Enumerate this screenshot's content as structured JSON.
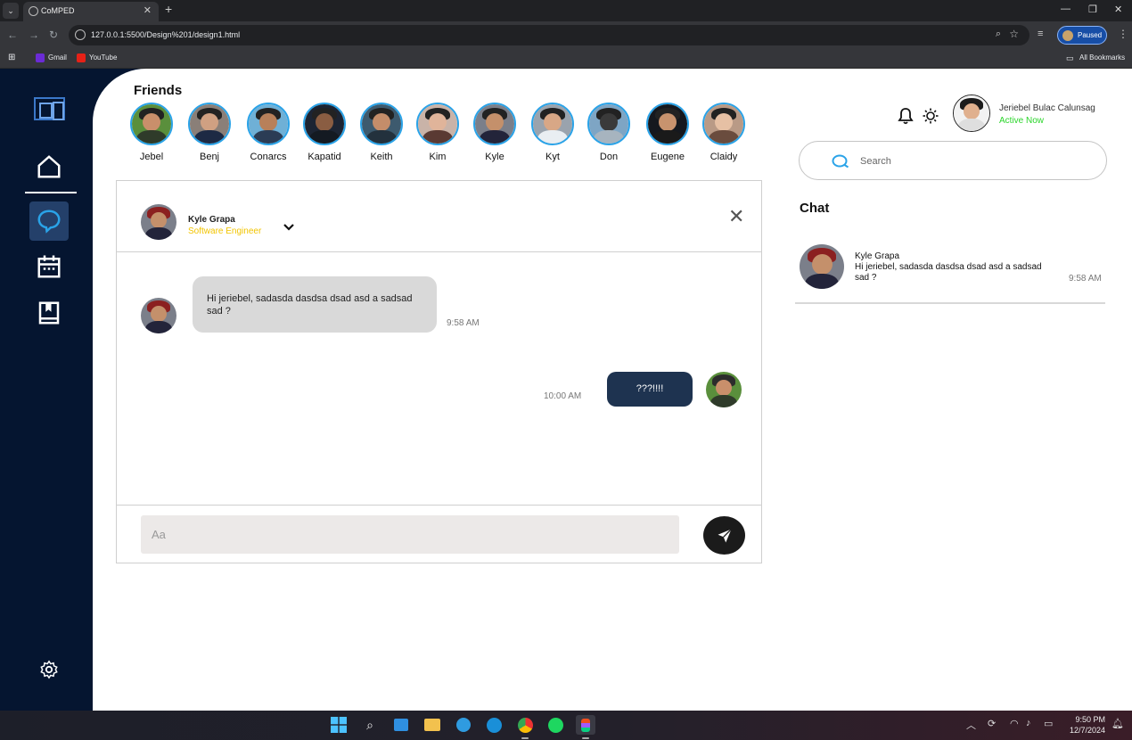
{
  "browser": {
    "tab_title": "CoMPED",
    "url": "127.0.0.1:5500/Design%201/design1.html",
    "profile_status": "Paused",
    "bookmarks": [
      "Gmail",
      "YouTube"
    ],
    "all_bookmarks": "All Bookmarks"
  },
  "friends": {
    "title": "Friends",
    "list": [
      {
        "name": "Jebel",
        "bg": "#5a8f3c",
        "skin": "#c98f6b",
        "shirt": "#2f3b2a"
      },
      {
        "name": "Benj",
        "bg": "#8a7f78",
        "skin": "#d0a082",
        "shirt": "#1d2a44"
      },
      {
        "name": "Conarcs",
        "bg": "#6fb0d6",
        "skin": "#b8805a",
        "shirt": "#2b3c55"
      },
      {
        "name": "Kapatid",
        "bg": "#1c2433",
        "skin": "#8a5d42",
        "shirt": "#141a22"
      },
      {
        "name": "Keith",
        "bg": "#3d5a6e",
        "skin": "#c48d6a",
        "shirt": "#23313d"
      },
      {
        "name": "Kim",
        "bg": "#c9b3a8",
        "skin": "#e0b49a",
        "shirt": "#5a3a33"
      },
      {
        "name": "Kyle",
        "bg": "#7b7f8a",
        "skin": "#c4906b",
        "shirt": "#23243a"
      },
      {
        "name": "Kyt",
        "bg": "#9aa3ad",
        "skin": "#d8a786",
        "shirt": "#e9eef2"
      },
      {
        "name": "Don",
        "bg": "#7ea5c4",
        "skin": "#3a3a3a",
        "shirt": "#a7b4bf"
      },
      {
        "name": "Eugene",
        "bg": "#15181e",
        "skin": "#c8936e",
        "shirt": "#1a1a1a"
      },
      {
        "name": "Claidy",
        "bg": "#b99a86",
        "skin": "#e6c0a4",
        "shirt": "#6a4c3e"
      }
    ]
  },
  "conversation": {
    "contact_name": "Kyle Grapa",
    "contact_role": "Software Engineer",
    "messages": [
      {
        "direction": "in",
        "text": "Hi jeriebel, sadasda dasdsa dsad asd a sadsad sad ?",
        "time": "9:58 AM"
      },
      {
        "direction": "out",
        "text": "???!!!!",
        "time": "10:00 AM"
      }
    ],
    "compose_placeholder": "Aa"
  },
  "user": {
    "name": "Jeriebel Bulac Calunsag",
    "status": "Active Now"
  },
  "search": {
    "placeholder": "Search"
  },
  "chat_list": {
    "title": "Chat",
    "items": [
      {
        "name": "Kyle Grapa",
        "preview": "Hi jeriebel, sadasda dasdsa dsad asd a sadsad sad ?",
        "time": "9:58 AM"
      }
    ]
  },
  "taskbar": {
    "time": "9:50 PM",
    "date": "12/7/2024"
  },
  "colors": {
    "sidebar": "#051530",
    "accent_blue": "#2aa3e8",
    "outgoing_bubble": "#1e3350",
    "incoming_bubble": "#d9d9d9",
    "role": "#f2c400",
    "active_now": "#2bd52b"
  }
}
